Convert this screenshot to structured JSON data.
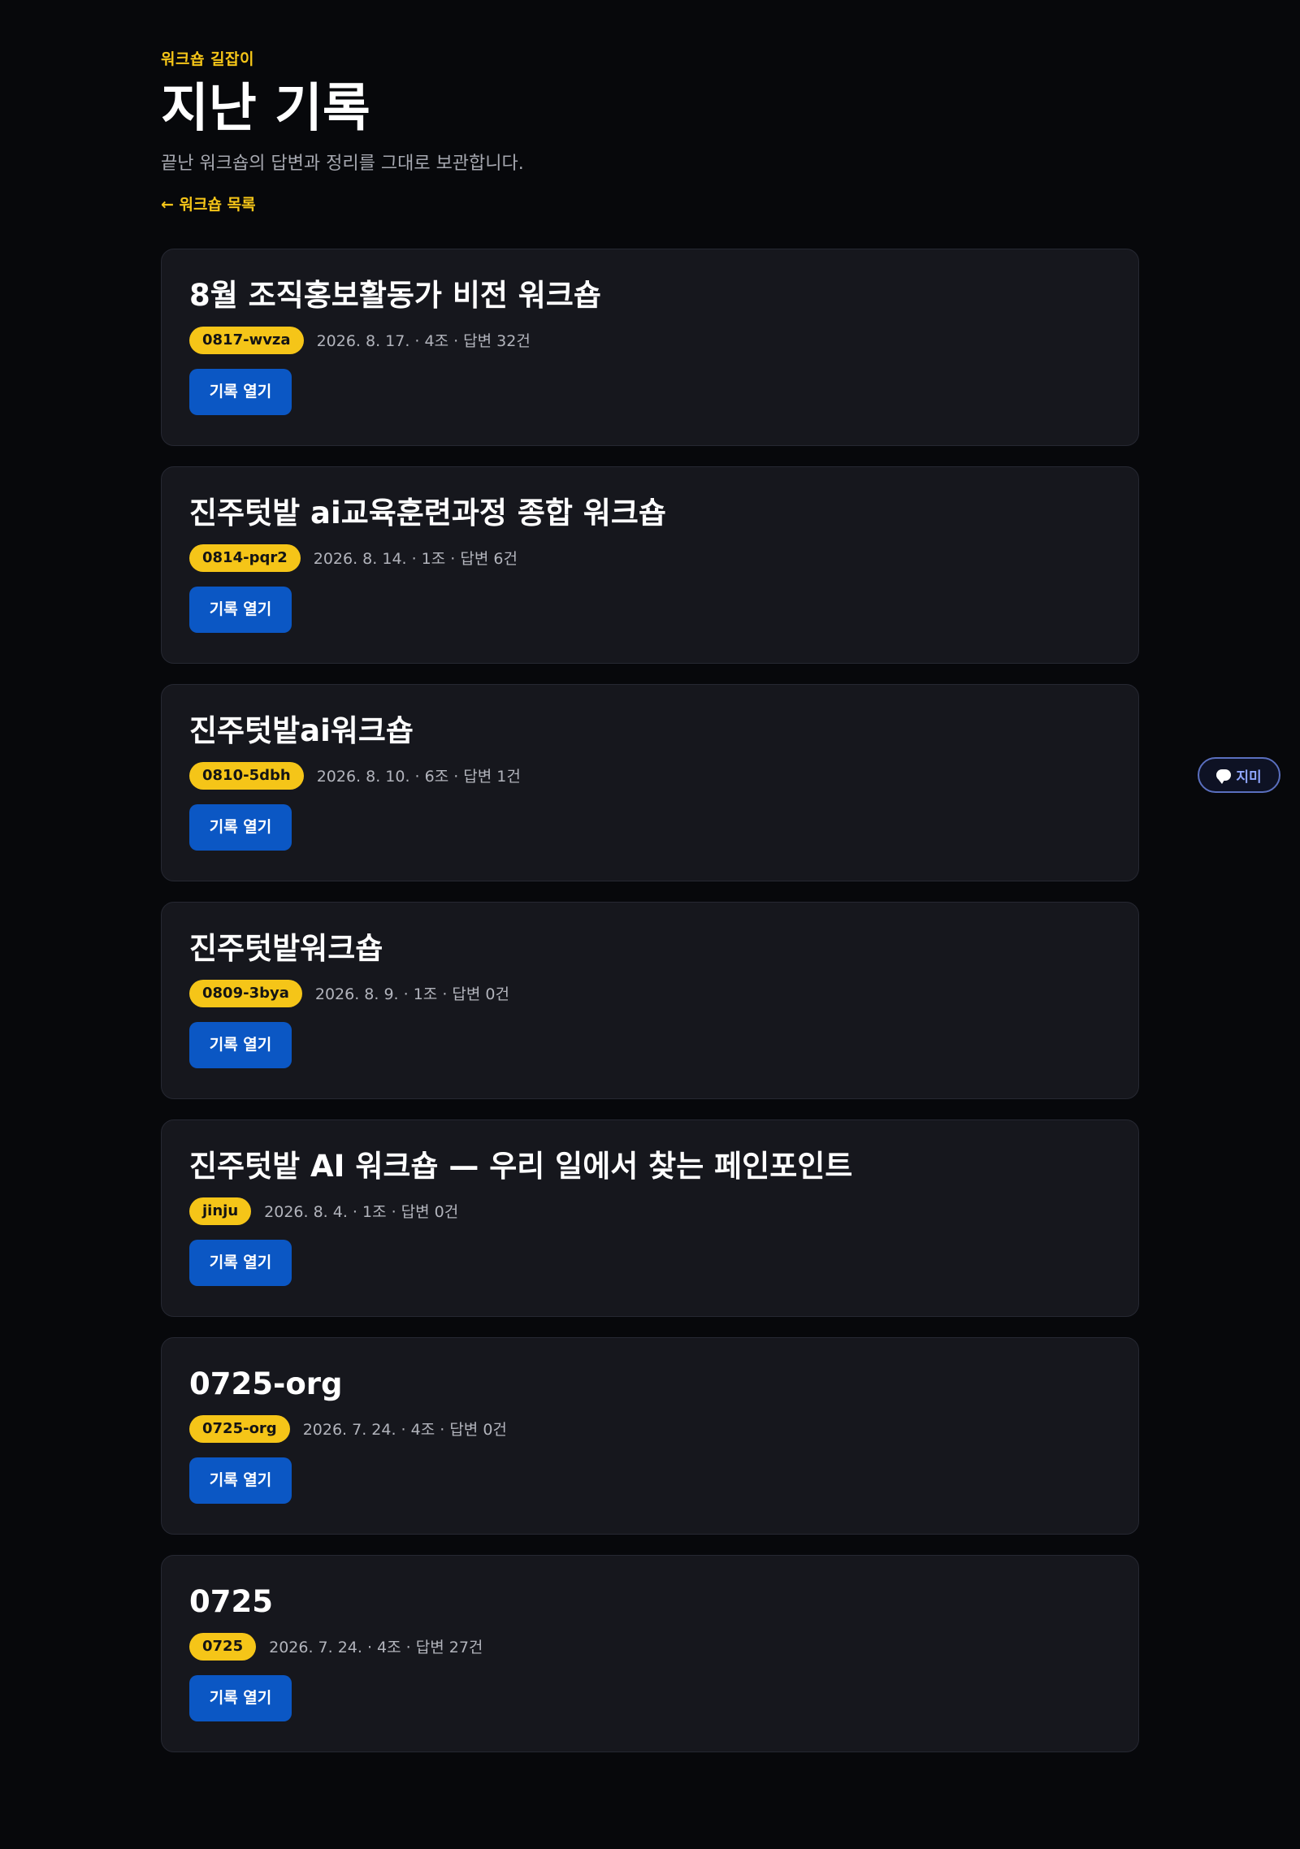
{
  "header": {
    "eyebrow": "워크숍 길잡이",
    "title": "지난 기록",
    "subtitle": "끝난 워크숍의 답변과 정리를 그대로 보관합니다.",
    "back_link": "← 워크숍 목록"
  },
  "records": [
    {
      "title": "8월 조직홍보활동가 비전 워크숍",
      "code": "0817-wvza",
      "meta": "2026. 8. 17. · 4조 · 답변 32건",
      "button": "기록 열기"
    },
    {
      "title": "진주텃밭 ai교육훈련과정 종합 워크숍",
      "code": "0814-pqr2",
      "meta": "2026. 8. 14. · 1조 · 답변 6건",
      "button": "기록 열기"
    },
    {
      "title": "진주텃밭ai워크숍",
      "code": "0810-5dbh",
      "meta": "2026. 8. 10. · 6조 · 답변 1건",
      "button": "기록 열기"
    },
    {
      "title": "진주텃밭워크숍",
      "code": "0809-3bya",
      "meta": "2026. 8. 9. · 1조 · 답변 0건",
      "button": "기록 열기"
    },
    {
      "title": "진주텃밭 AI 워크숍 — 우리 일에서 찾는 페인포인트",
      "code": "jinju",
      "meta": "2026. 8. 4. · 1조 · 답변 0건",
      "button": "기록 열기"
    },
    {
      "title": "0725-org",
      "code": "0725-org",
      "meta": "2026. 7. 24. · 4조 · 답변 0건",
      "button": "기록 열기"
    },
    {
      "title": "0725",
      "code": "0725",
      "meta": "2026. 7. 24. · 4조 · 답변 27건",
      "button": "기록 열기"
    }
  ],
  "chat": {
    "label": "지미",
    "icon": "speech-bubble-icon"
  }
}
